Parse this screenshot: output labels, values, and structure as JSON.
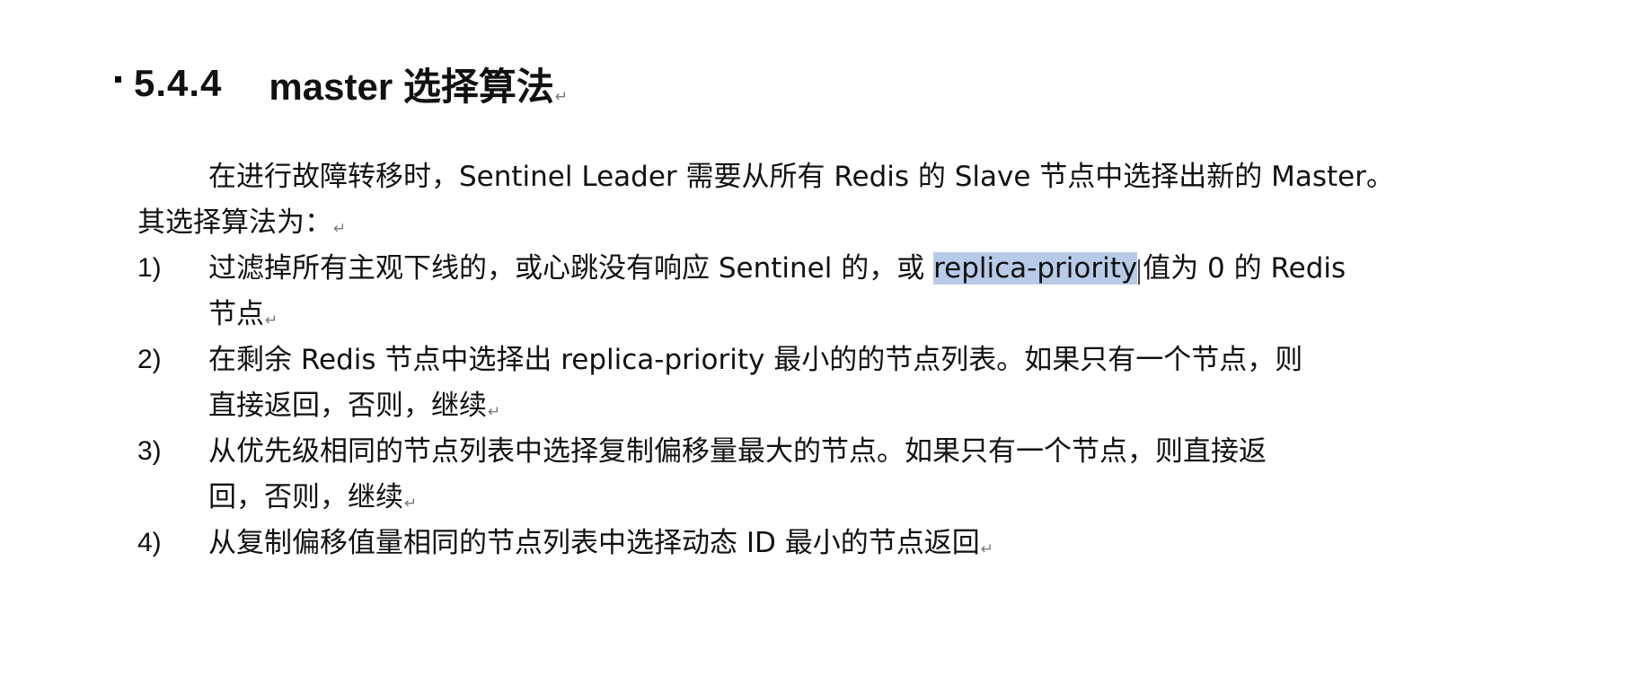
{
  "section": {
    "number": "5.4.4",
    "title": "master 选择算法"
  },
  "intro": {
    "line1": "在进行故障转移时，Sentinel Leader 需要从所有 Redis 的 Slave 节点中选择出新的 Master。",
    "line2": "其选择算法为："
  },
  "items": [
    {
      "num": "1)",
      "line1_before": "过滤掉所有主观下线的，或心跳没有响应 Sentinel 的，或 ",
      "line1_highlight": "replica-priority",
      "line1_after": "值为 0 的 Redis",
      "line2": "节点"
    },
    {
      "num": "2)",
      "line1": "在剩余 Redis 节点中选择出 replica-priority 最小的的节点列表。如果只有一个节点，则",
      "line2": "直接返回，否则，继续"
    },
    {
      "num": "3)",
      "line1": "从优先级相同的节点列表中选择复制偏移量最大的节点。如果只有一个节点，则直接返",
      "line2": "回，否则，继续"
    },
    {
      "num": "4)",
      "line1": "从复制偏移值量相同的节点列表中选择动态 ID 最小的节点返回"
    }
  ],
  "paragraph_mark": "↵",
  "colors": {
    "highlight": "#b7cbe8",
    "text": "#111111"
  }
}
